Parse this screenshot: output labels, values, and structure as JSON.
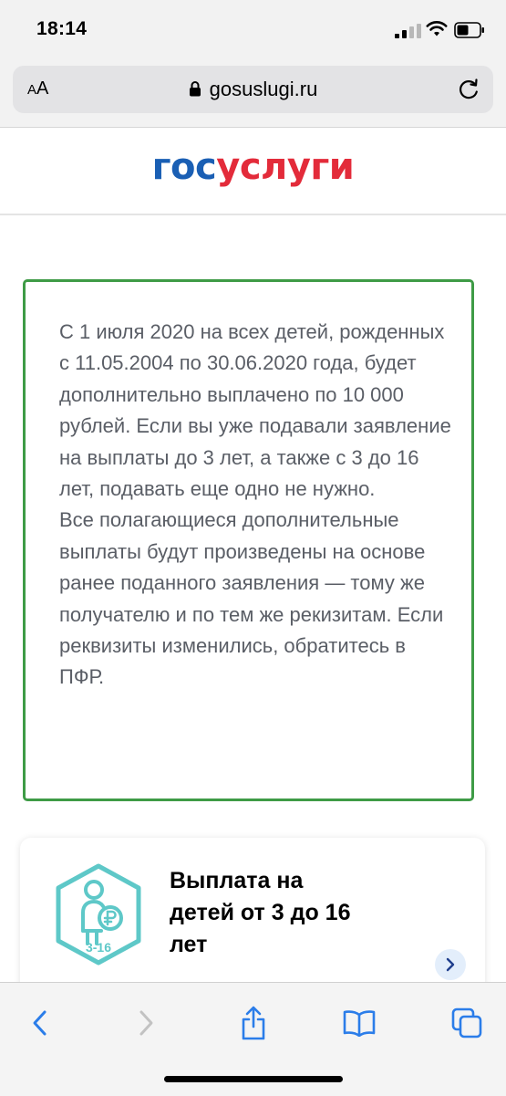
{
  "status_bar": {
    "time": "18:14"
  },
  "browser": {
    "aa_label_small": "A",
    "aa_label_large": "A",
    "url": "gosuslugi.ru"
  },
  "header": {
    "logo_part1": "гос",
    "logo_part2": "услуги"
  },
  "notice": {
    "paragraph1": "С 1 июля 2020 на всех детей, рожденных с 11.05.2004 по 30.06.2020 года, будет дополнительно выплачено по 10 000 рублей. Если вы уже подавали заявление на выплаты до 3 лет, а также с 3 до 16 лет, подавать еще одно не нужно.",
    "paragraph2": "Все полагающиеся дополнительные выплаты будут произведены на основе ранее поданного заявления — тому же получателю и по тем же рекизитам. Если реквизиты изменились, обратитесь в ПФР."
  },
  "card": {
    "title": "Выплата на детей от 3 до 16 лет",
    "badge": "3-16",
    "icon": "child-ruble-icon"
  },
  "colors": {
    "logo_blue": "#1a5fb4",
    "logo_red": "#e32b3a",
    "notice_border": "#3e9b46",
    "accent_blue": "#2b7de9",
    "icon_teal": "#5ec8c8"
  }
}
